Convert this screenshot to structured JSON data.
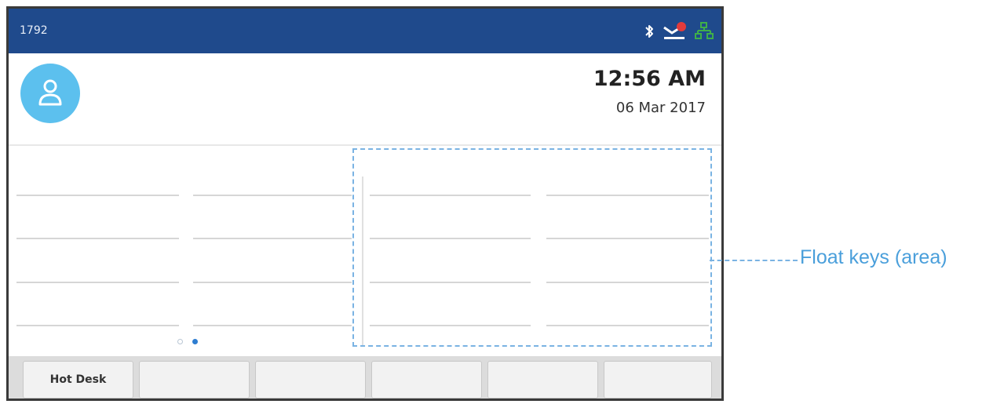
{
  "header": {
    "extension": "1792",
    "icons": [
      "bluetooth-icon",
      "voicemail-icon",
      "network-icon"
    ],
    "voicemail_badge": "1"
  },
  "clock": {
    "time": "12:56 AM",
    "date": "06 Mar 2017"
  },
  "pager": {
    "pages": 2,
    "active_page": 2
  },
  "softkeys": [
    "Hot Desk",
    "",
    "",
    "",
    "",
    ""
  ],
  "annotation": {
    "label": "Float keys (area)"
  },
  "colors": {
    "header_bg": "#1f4a8c",
    "avatar_bg": "#5cc0ee",
    "accent_blue": "#4a9fdb",
    "network_green": "#3fae49",
    "badge_red": "#e23b3b"
  }
}
